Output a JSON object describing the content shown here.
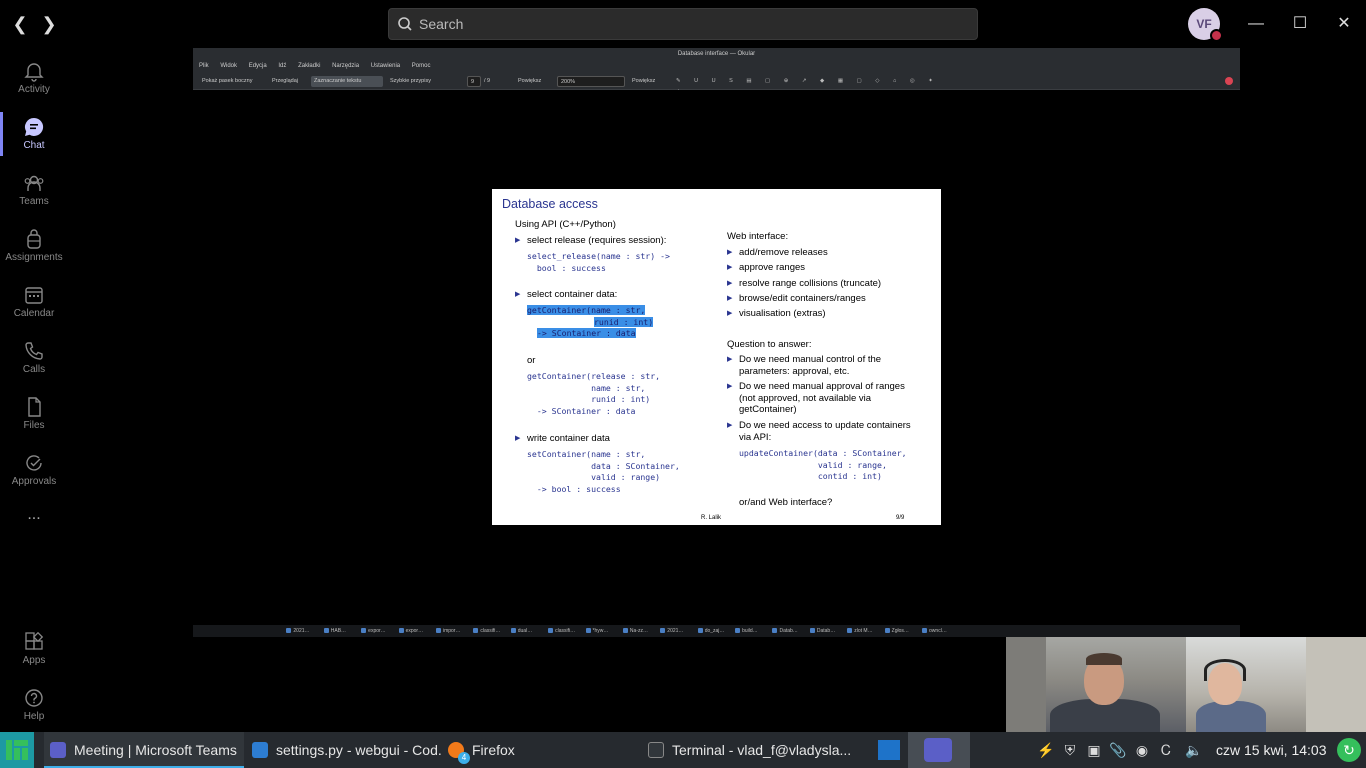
{
  "teams": {
    "search_placeholder": "Search",
    "avatar_initials": "VF",
    "rail": [
      {
        "label": "Activity"
      },
      {
        "label": "Chat"
      },
      {
        "label": "Teams"
      },
      {
        "label": "Assignments"
      },
      {
        "label": "Calendar"
      },
      {
        "label": "Calls"
      },
      {
        "label": "Files"
      },
      {
        "label": "Approvals"
      },
      {
        "label": "..."
      },
      {
        "label": "Apps"
      },
      {
        "label": "Help"
      }
    ]
  },
  "okular": {
    "window_title": "Database interface — Okular",
    "menu": [
      "Plik",
      "Widok",
      "Edycja",
      "Idź",
      "Zakładki",
      "Narzędzia",
      "Ustawienia",
      "Pomoc"
    ],
    "toolbar": {
      "sidebar": "Pokaż pasek boczny",
      "browse": "Przeglądaj",
      "text_select": "Zaznaczanie tekstu",
      "quick_annot": "Szybkie przypisy",
      "page_current": "9",
      "page_total": "/ 9",
      "fit": "Powiększ",
      "zoom": "200%",
      "annotate": "Powiększ"
    }
  },
  "slide": {
    "title": "Database access",
    "left": {
      "intro": "Using API (C++/Python)",
      "b1": "select release (requires session):",
      "c1": "select_release(name : str) ->\n  bool : success",
      "b2": "select container data:",
      "c2a": "getContainer(name : str,",
      "c2b": "runid : int)",
      "c2c": "-> SContainer : data",
      "or": "or",
      "c3": "getContainer(release : str,\n             name : str,\n             runid : int)\n  -> SContainer : data",
      "b3": "write container data",
      "c4": "setContainer(name : str,\n             data : SContainer,\n             valid : range)\n  -> bool : success"
    },
    "right": {
      "web": "Web interface:",
      "items": [
        "add/remove releases",
        "approve ranges",
        "resolve range collisions (truncate)",
        "browse/edit containers/ranges",
        "visualisation (extras)"
      ],
      "question": "Question to answer:",
      "q1": "Do we need manual control of the\nparameters: approval, etc.",
      "q2": "Do we need manual approval of ranges\n(not approved, not available via\ngetContainer)",
      "q3": "Do we need access to update containers\nvia API:",
      "c5": "updateContainer(data : SContainer,\n                valid : range,\n                contid : int)",
      "end": "or/and Web interface?"
    },
    "footer_author": "R. Lalik",
    "footer_page": "9/9"
  },
  "inner_taskbar": [
    "2021…",
    "HAB…",
    "expor…",
    "expor…",
    "impor…",
    "classifi…",
    "dual…",
    "classifi…",
    "*hyw…",
    "Na-zz…",
    "2021…",
    "do_zaj…",
    "build…",
    "Datab…",
    "Datab…",
    "zlot M…",
    "Zgłos…",
    "owncl…"
  ],
  "taskbar": {
    "tasks": [
      {
        "label": "Meeting | Microsoft Teams"
      },
      {
        "label": "settings.py - webgui - Cod..."
      },
      {
        "label": "Firefox"
      },
      {
        "label": "Terminal - vlad_f@vladysla..."
      }
    ],
    "firefox_badge": "4",
    "clock": "czw 15 kwi, 14:03"
  }
}
